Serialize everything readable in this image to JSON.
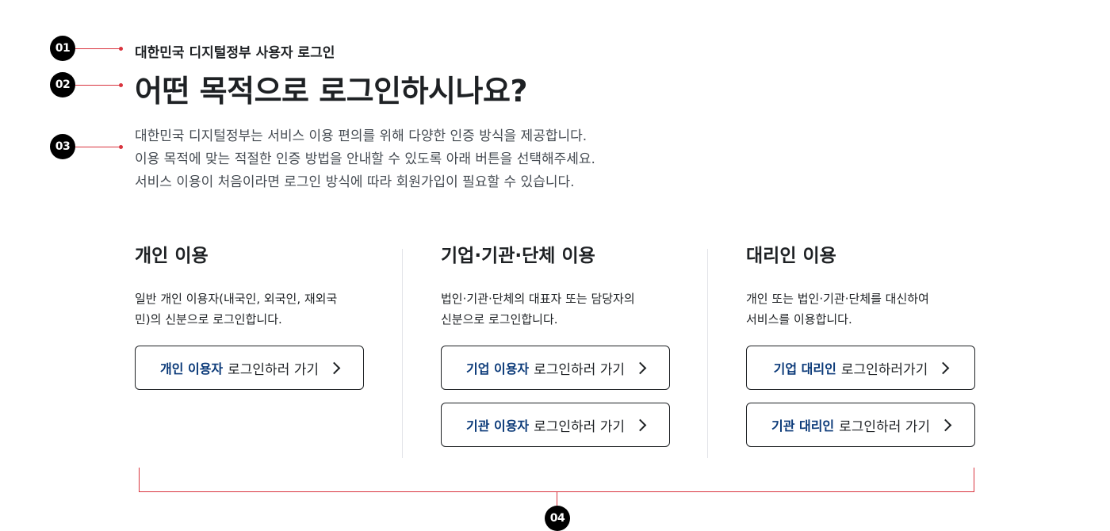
{
  "markers": [
    "01",
    "02",
    "03",
    "04"
  ],
  "header": {
    "eyebrow": "대한민국 디지털정부 사용자 로그인",
    "title": "어떤 목적으로 로그인하시나요?",
    "description": [
      "대한민국 디지털정부는 서비스 이용 편의를 위해 다양한 인증 방식을 제공합니다.",
      "이용 목적에 맞는 적절한 인증 방법을 안내할 수 있도록 아래 버튼을 선택해주세요.",
      "서비스 이용이 처음이라면 로그인 방식에 따라 회원가입이 필요할 수 있습니다."
    ]
  },
  "columns": [
    {
      "title": "개인 이용",
      "description": [
        "일반 개인 이용자(내국인, 외국인, 재외국",
        "민)의 신분으로 로그인합니다."
      ],
      "buttons": [
        {
          "strong": "개인 이용자",
          "rest": "로그인하러 가기"
        }
      ]
    },
    {
      "title": "기업·기관·단체 이용",
      "description": [
        "법인·기관·단체의 대표자 또는 담당자의",
        "신분으로 로그인합니다."
      ],
      "buttons": [
        {
          "strong": "기업 이용자",
          "rest": "로그인하러 가기"
        },
        {
          "strong": "기관 이용자",
          "rest": "로그인하러 가기"
        }
      ]
    },
    {
      "title": "대리인 이용",
      "description": [
        "개인 또는 법인·기관·단체를 대신하여",
        "서비스를 이용합니다."
      ],
      "buttons": [
        {
          "strong": "기업 대리인",
          "rest": "로그인하러가기"
        },
        {
          "strong": "기관 대리인",
          "rest": "로그인하러 가기"
        }
      ]
    }
  ],
  "icons": {
    "button_arrow": "chevron-right-icon"
  },
  "colors": {
    "accent_red": "#d9343e",
    "link_blue": "#0b3a79",
    "text": "#1e2124"
  }
}
